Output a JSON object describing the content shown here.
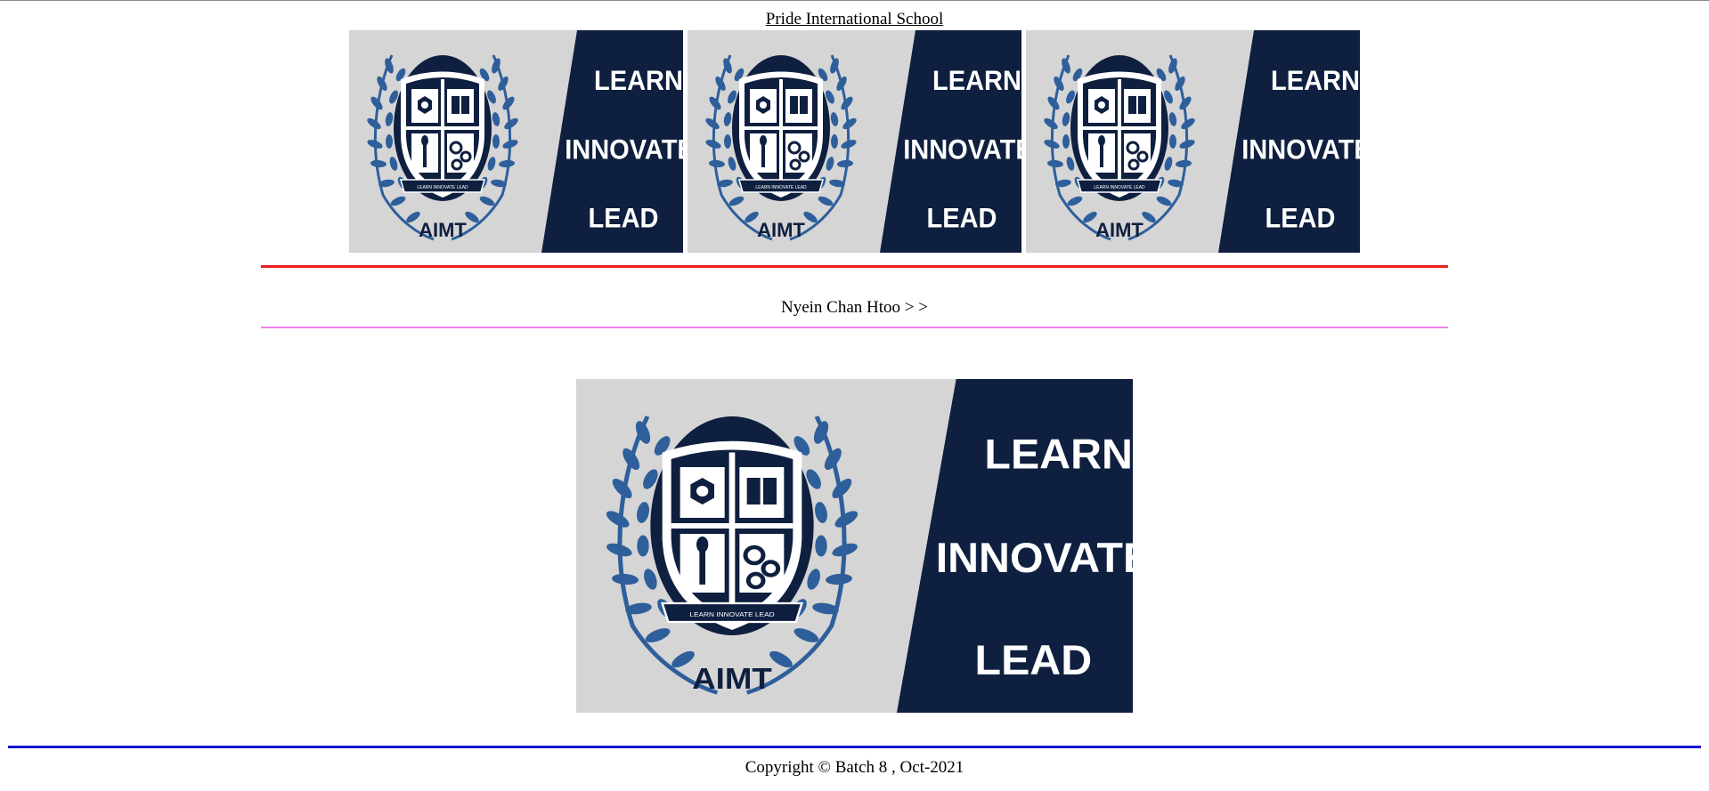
{
  "header": {
    "title": "Pride International School"
  },
  "banner": {
    "school_abbrev": "AIMT",
    "motto_lines": [
      "LEARN",
      "INNOVATE",
      "LEAD"
    ],
    "ribbon_text": "LEARN  INNOVATE  LEAD",
    "colors": {
      "background": "#d5d5d5",
      "navy": "#0f1f3f",
      "laurel": "#2e5f9b"
    }
  },
  "breadcrumb": {
    "text": "Nyein Chan Htoo > >"
  },
  "divider_colors": {
    "top": "#ec1f1f",
    "middle": "#ee82ee",
    "bottom": "#1414d2"
  },
  "footer": {
    "copyright": "Copyright © Batch 8 , Oct-2021"
  }
}
